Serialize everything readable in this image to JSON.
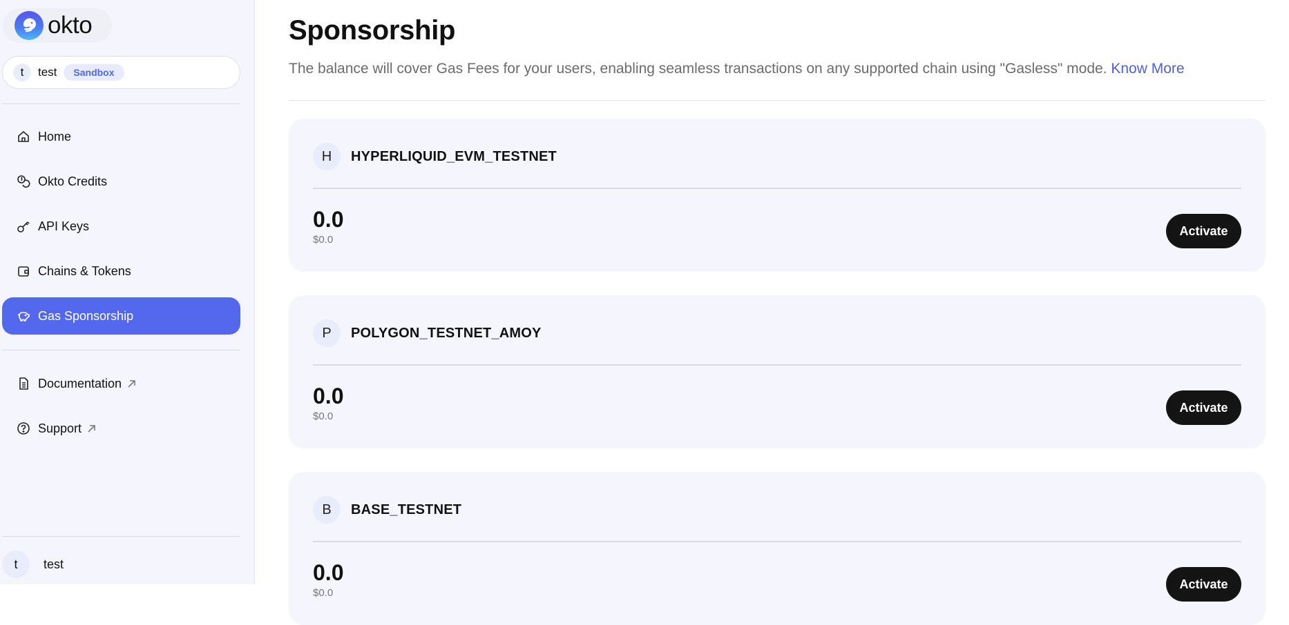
{
  "brand": {
    "name": "okto",
    "logo_icon": "okto-octopus-logo-icon"
  },
  "workspace": {
    "avatar_letter": "t",
    "name": "test",
    "badge": "Sandbox"
  },
  "sidebar": {
    "items": [
      {
        "label": "Home",
        "icon": "home-icon",
        "active": false
      },
      {
        "label": "Okto Credits",
        "icon": "coins-icon",
        "active": false
      },
      {
        "label": "API Keys",
        "icon": "key-icon",
        "active": false
      },
      {
        "label": "Chains & Tokens",
        "icon": "wallet-icon",
        "active": false
      },
      {
        "label": "Gas Sponsorship",
        "icon": "piggy-bank-icon",
        "active": true
      }
    ],
    "links": [
      {
        "label": "Documentation",
        "icon": "document-icon",
        "external": true
      },
      {
        "label": "Support",
        "icon": "help-circle-icon",
        "external": true
      }
    ],
    "user": {
      "avatar_letter": "t",
      "name": "test"
    }
  },
  "page": {
    "title": "Sponsorship",
    "description": "The balance will cover Gas Fees for your users, enabling seamless transactions on any supported chain using \"Gasless\" mode.",
    "know_more": "Know More"
  },
  "chains": [
    {
      "letter": "H",
      "name": "HYPERLIQUID_EVM_TESTNET",
      "balance": "0.0",
      "balance_usd": "$0.0",
      "action": "Activate"
    },
    {
      "letter": "P",
      "name": "POLYGON_TESTNET_AMOY",
      "balance": "0.0",
      "balance_usd": "$0.0",
      "action": "Activate"
    },
    {
      "letter": "B",
      "name": "BASE_TESTNET",
      "balance": "0.0",
      "balance_usd": "$0.0",
      "action": "Activate"
    }
  ],
  "colors": {
    "accent": "#5468ee",
    "link": "#4f5fe0",
    "button_dark": "#141414",
    "badge_text": "#5167e0"
  }
}
